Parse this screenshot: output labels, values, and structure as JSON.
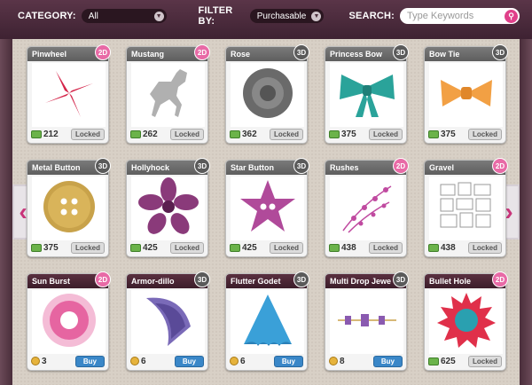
{
  "toolbar": {
    "category_label": "CATEGORY:",
    "category_value": "All",
    "filter_label": "FILTER BY:",
    "filter_value": "Purchasable",
    "search_label": "SEARCH:",
    "search_placeholder": "Type Keywords"
  },
  "colors": {
    "accent": "#e0408a",
    "topbar": "#4a2a3a",
    "buy": "#3a87c8",
    "badge_2d": "#e86aa6",
    "badge_3d": "#5a5a5a"
  },
  "items": [
    {
      "name": "Pinwheel",
      "dim": "2D",
      "price": "212",
      "status": "Locked",
      "currency": "coins",
      "icon": "pinwheel-icon",
      "color": "#d4254a"
    },
    {
      "name": "Mustang",
      "dim": "2D",
      "price": "262",
      "status": "Locked",
      "currency": "coins",
      "icon": "horse-icon",
      "color": "#b0b0b0"
    },
    {
      "name": "Rose",
      "dim": "3D",
      "price": "362",
      "status": "Locked",
      "currency": "coins",
      "icon": "rose-icon",
      "color": "#6a6a6a"
    },
    {
      "name": "Princess Bow",
      "dim": "3D",
      "price": "375",
      "status": "Locked",
      "currency": "coins",
      "icon": "bow-icon",
      "color": "#2aa39a"
    },
    {
      "name": "Bow Tie",
      "dim": "3D",
      "price": "375",
      "status": "Locked",
      "currency": "coins",
      "icon": "bowtie-icon",
      "color": "#f2a044"
    },
    {
      "name": "Metal Button",
      "dim": "3D",
      "price": "375",
      "status": "Locked",
      "currency": "coins",
      "icon": "button-icon",
      "color": "#c8a24a"
    },
    {
      "name": "Hollyhock",
      "dim": "3D",
      "price": "425",
      "status": "Locked",
      "currency": "coins",
      "icon": "flower-icon",
      "color": "#8a3a7a"
    },
    {
      "name": "Star Button",
      "dim": "3D",
      "price": "425",
      "status": "Locked",
      "currency": "coins",
      "icon": "star-icon",
      "color": "#b04a9a"
    },
    {
      "name": "Rushes",
      "dim": "2D",
      "price": "438",
      "status": "Locked",
      "currency": "coins",
      "icon": "rushes-icon",
      "color": "#c04aa0"
    },
    {
      "name": "Gravel",
      "dim": "2D",
      "price": "438",
      "status": "Locked",
      "currency": "coins",
      "icon": "gravel-icon",
      "color": "#9a9a9a"
    },
    {
      "name": "Sun Burst",
      "dim": "2D",
      "price": "3",
      "status": "Buy",
      "currency": "gold",
      "icon": "sunburst-icon",
      "color": "#e0408a"
    },
    {
      "name": "Armor-dillo",
      "dim": "3D",
      "price": "6",
      "status": "Buy",
      "currency": "gold",
      "icon": "armor-icon",
      "color": "#7a6ab8"
    },
    {
      "name": "Flutter Godet",
      "dim": "3D",
      "price": "6",
      "status": "Buy",
      "currency": "gold",
      "icon": "godet-icon",
      "color": "#3aa0d8"
    },
    {
      "name": "Multi Drop Jewe",
      "dim": "3D",
      "price": "8",
      "status": "Buy",
      "currency": "gold",
      "icon": "jewel-chain-icon",
      "color": "#8a5ab0"
    },
    {
      "name": "Bullet Hole",
      "dim": "2D",
      "price": "625",
      "status": "Locked",
      "currency": "coins",
      "icon": "bullet-hole-icon",
      "color": "#e0304a"
    }
  ]
}
